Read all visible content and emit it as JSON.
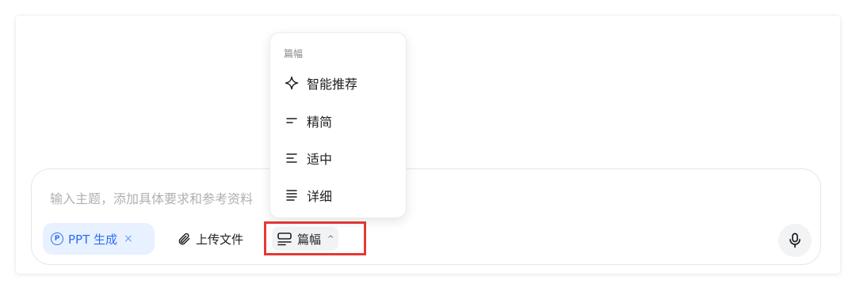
{
  "composer": {
    "placeholder": "输入主题，添加具体要求和参考资料"
  },
  "toolbar": {
    "ppt_chip_label": "PPT 生成",
    "ppt_chip_close": "×",
    "upload_label": "上传文件",
    "length_label": "篇幅",
    "length_caret": "^"
  },
  "length_menu": {
    "header": "篇幅",
    "items": [
      {
        "label": "智能推荐",
        "icon": "sparkle-icon"
      },
      {
        "label": "精简",
        "icon": "lines-short-icon"
      },
      {
        "label": "适中",
        "icon": "lines-medium-icon"
      },
      {
        "label": "详细",
        "icon": "lines-long-icon"
      }
    ]
  },
  "colors": {
    "accent": "#2b6ff6",
    "chip_bg": "#e8f1ff",
    "highlight": "#e53935"
  }
}
